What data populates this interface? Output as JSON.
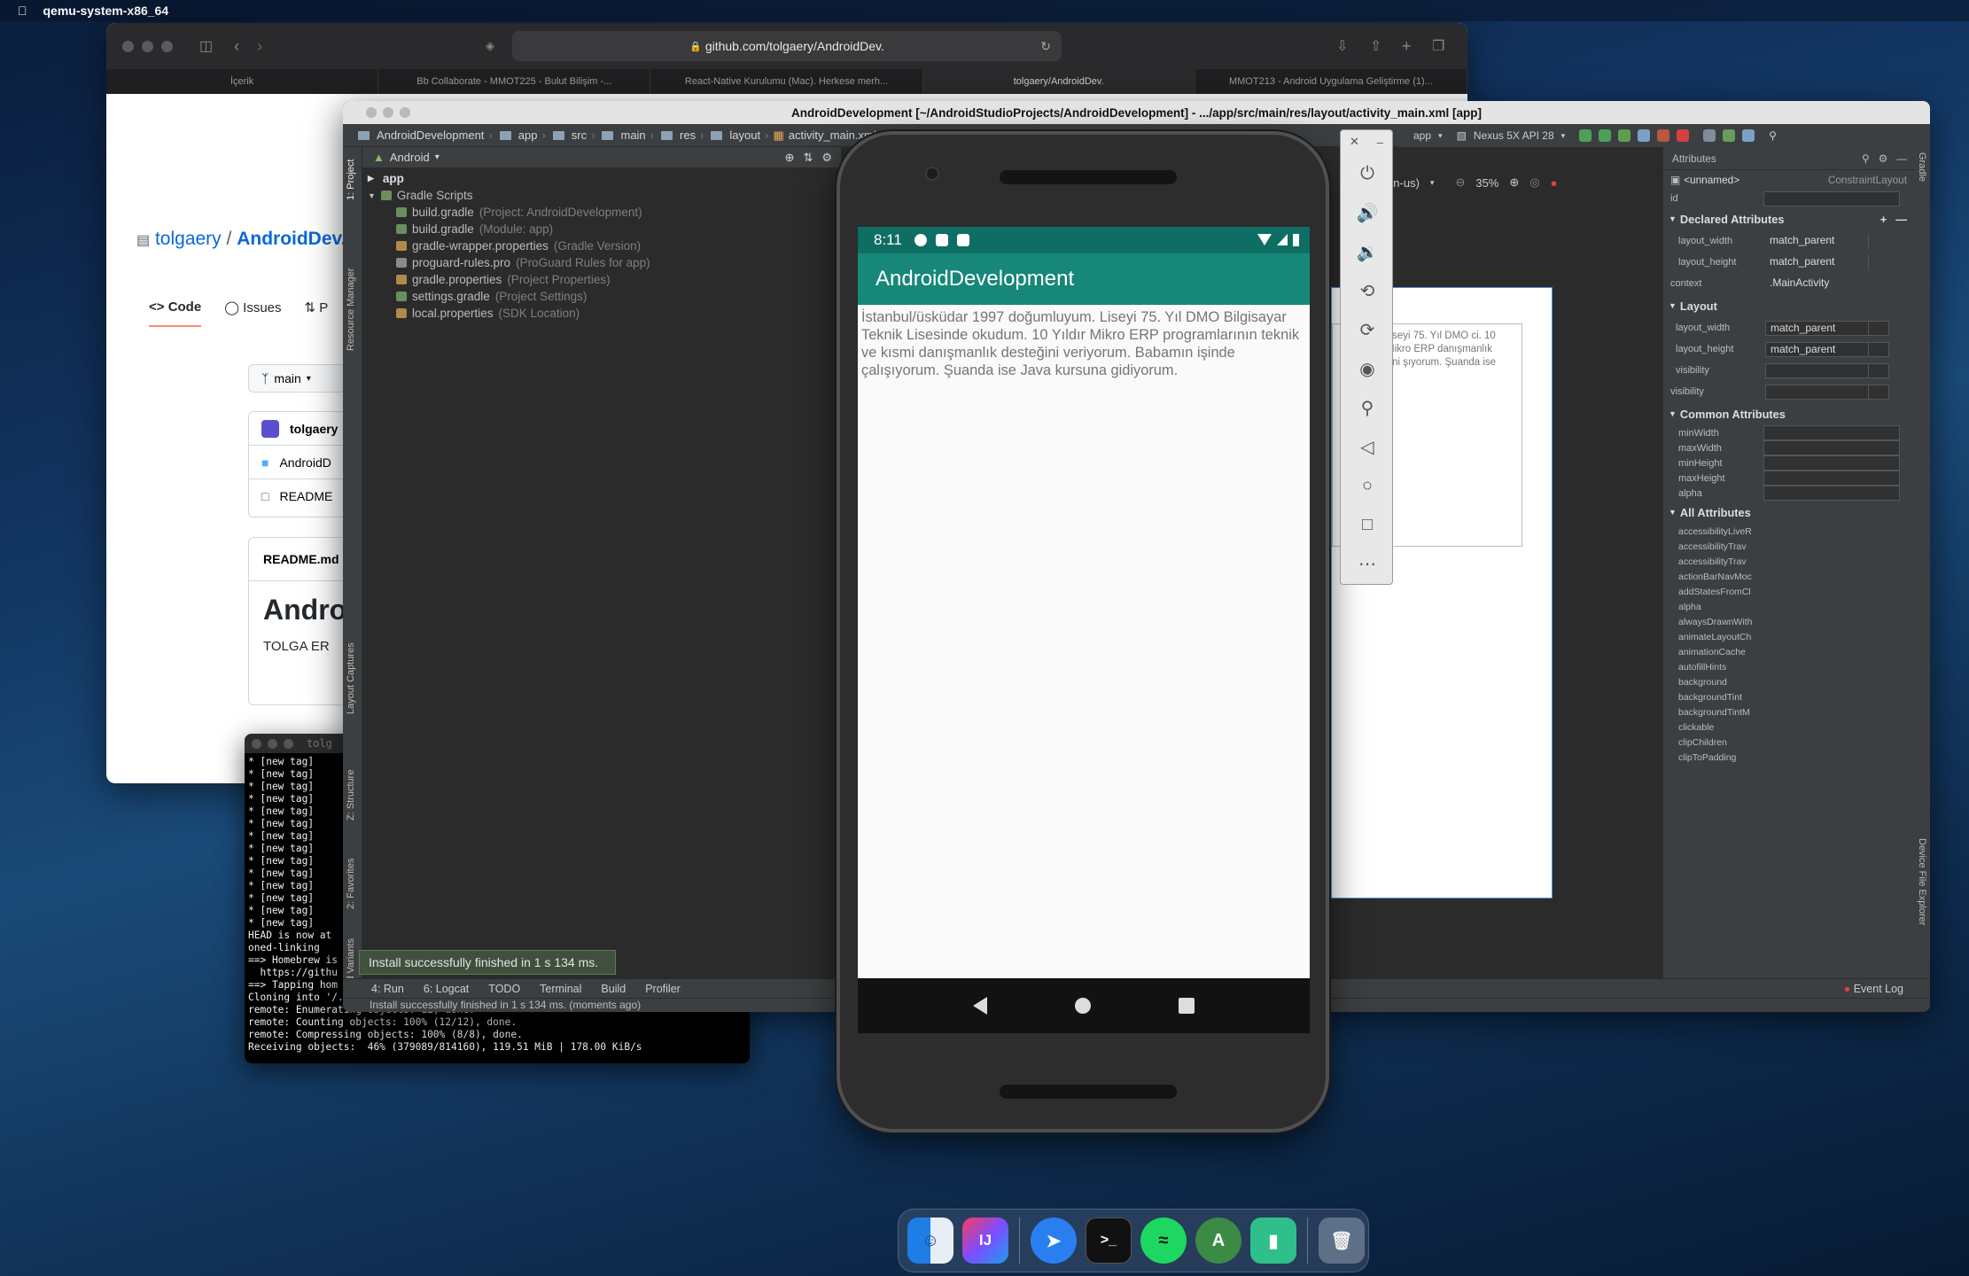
{
  "menubar": {
    "app_name": "qemu-system-x86_64"
  },
  "safari": {
    "url": "github.com/tolgaery/AndroidDev.",
    "tabs": [
      "İçerik",
      "Bb Collaborate - MMOT225 - Bulut Bilişim -...",
      "React-Native Kurulumu (Mac). Herkese merh...",
      "tolgaery/AndroidDev.",
      "MMOT213 - Android Uygulama Geliştirme (1)..."
    ],
    "repo_owner": "tolgaery",
    "repo_sep": " / ",
    "repo_name": "AndroidDev.",
    "nav": {
      "code": "Code",
      "issues": "Issues",
      "pr": "P"
    },
    "branch": "main",
    "files": [
      "tolgaery",
      "AndroidD",
      "README"
    ],
    "readme_label": "README.md",
    "readme_title": "Andro",
    "readme_text": "TOLGA ER"
  },
  "terminal": {
    "title": "tolg",
    "lines": [
      "* [new tag]",
      "* [new tag]",
      "* [new tag]",
      "* [new tag]",
      "* [new tag]",
      "* [new tag]",
      "* [new tag]",
      "* [new tag]",
      "* [new tag]",
      "* [new tag]",
      "* [new tag]",
      "* [new tag]",
      "* [new tag]",
      "* [new tag]",
      "HEAD is now at",
      "oned-linking",
      "==> Homebrew is",
      "  https://githu",
      "==> Tapping hom",
      "Cloning into '/.",
      "remote: Enumerating objects: 12, done.",
      "remote: Counting objects: 100% (12/12), done.",
      "remote: Compressing objects: 100% (8/8), done.",
      "Receiving objects:  46% (379089/814160), 119.51 MiB | 178.00 KiB/s"
    ]
  },
  "studio": {
    "title": "AndroidDevelopment [~/AndroidStudioProjects/AndroidDevelopment] - .../app/src/main/res/layout/activity_main.xml [app]",
    "crumbs": [
      "AndroidDevelopment",
      "app",
      "src",
      "main",
      "res",
      "layout",
      "activity_main.xml"
    ],
    "view_mode": "Android",
    "tree": [
      {
        "name": "app",
        "note": ""
      },
      {
        "name": "Gradle Scripts",
        "note": ""
      },
      {
        "name": "build.gradle",
        "note": "(Project: AndroidDevelopment)"
      },
      {
        "name": "build.gradle",
        "note": "(Module: app)"
      },
      {
        "name": "gradle-wrapper.properties",
        "note": "(Gradle Version)"
      },
      {
        "name": "proguard-rules.pro",
        "note": "(ProGuard Rules for app)"
      },
      {
        "name": "gradle.properties",
        "note": "(Project Properties)"
      },
      {
        "name": "settings.gradle",
        "note": "(Project Settings)"
      },
      {
        "name": "local.properties",
        "note": "(SDK Location)"
      }
    ],
    "left_tools": [
      "1: Project",
      "Resource Manager",
      "Layout Captures",
      "Z: Structure",
      "2: Favorites",
      "Build Variants"
    ],
    "run_config": "app",
    "device": "Nexus 5X API 28",
    "locale": "Default (en-us)",
    "zoom": "35%",
    "blueprint_text": "yum. Liseyi 75. Yıl DMO ci. 10 Yıldır Mikro ERP danışmanlık desteğini şıyorum. Şuanda ise",
    "attributes": {
      "header": "Attributes",
      "component": "<unnamed>",
      "component_type": "ConstraintLayout",
      "id_label": "id",
      "declared_title": "Declared Attributes",
      "declared": [
        {
          "k": "layout_width",
          "v": "match_parent"
        },
        {
          "k": "layout_height",
          "v": "match_parent"
        },
        {
          "k": "context",
          "v": ".MainActivity"
        }
      ],
      "layout_title": "Layout",
      "layout": [
        {
          "k": "layout_width",
          "v": "match_parent"
        },
        {
          "k": "layout_height",
          "v": "match_parent"
        },
        {
          "k": "visibility",
          "v": ""
        },
        {
          "k": "visibility",
          "v": ""
        }
      ],
      "common_title": "Common Attributes",
      "common": [
        "minWidth",
        "maxWidth",
        "minHeight",
        "maxHeight",
        "alpha"
      ],
      "all_title": "All Attributes",
      "all": [
        "accessibilityLiveR",
        "accessibilityTrav",
        "accessibilityTrav",
        "actionBarNavMoc",
        "addStatesFromCl",
        "alpha",
        "alwaysDrawnWith",
        "animateLayoutCh",
        "animationCache",
        "autofillHints",
        "background",
        "backgroundTint",
        "backgroundTintM",
        "clickable",
        "clipChildren",
        "clipToPadding"
      ]
    },
    "right_tools": [
      "Gradle",
      "Device File Explorer"
    ],
    "bottom_tabs": [
      "4: Run",
      "6: Logcat",
      "TODO",
      "Terminal",
      "Build",
      "Profiler"
    ],
    "event_log": "Event Log",
    "balloon": "Install successfully finished in 1 s 134 ms.",
    "status": "Install successfully finished in 1 s 134 ms. (moments ago)"
  },
  "phone": {
    "time": "8:11",
    "app_title": "AndroidDevelopment",
    "body": "İstanbul/üsküdar 1997 doğumluyum. Liseyi 75. Yıl DMO Bilgisayar Teknik Lisesinde okudum. 10 Yıldır Mikro ERP programlarının teknik ve kısmi danışmanlık desteğini veriyorum. Babamın işinde çalışıyorum. Şuanda ise Java kursuna gidiyorum."
  },
  "dock": {
    "apps": [
      "finder-icon",
      "intellij-icon",
      "safari-icon",
      "terminal-icon",
      "spotify-icon",
      "android-studio-icon",
      "app-icon",
      "trash-icon"
    ]
  }
}
